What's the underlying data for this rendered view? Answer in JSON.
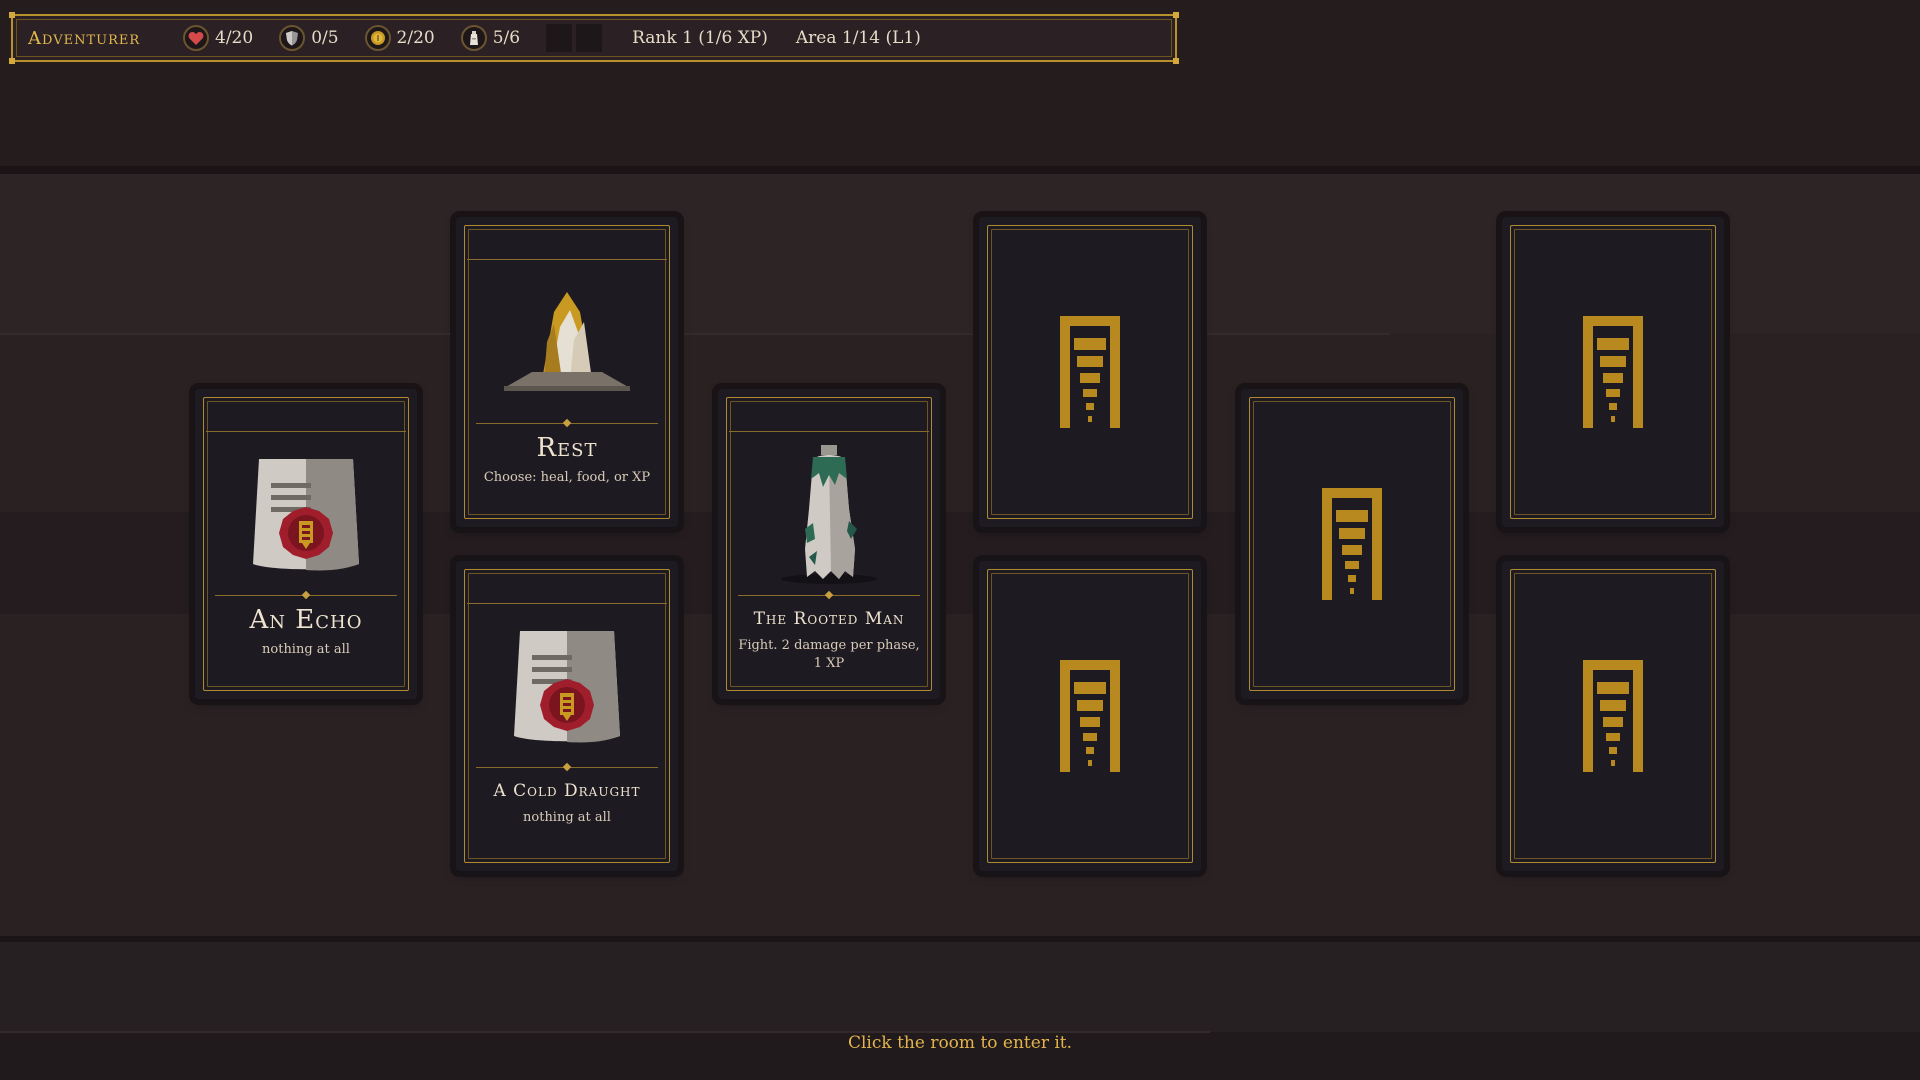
{
  "hud": {
    "title": "Adventurer",
    "health": "4/20",
    "armor": "0/5",
    "gold": "2/20",
    "food": "5/6",
    "rank": "Rank 1 (1/6 XP)",
    "area": "Area 1/14 (L1)"
  },
  "cards": {
    "echo": {
      "title": "An Echo",
      "desc": "nothing at all"
    },
    "rest": {
      "title": "Rest",
      "desc": "Choose: heal, food, or XP"
    },
    "cold_draught": {
      "title": "A Cold Draught",
      "desc": "nothing at all"
    },
    "rooted_man": {
      "title": "The Rooted Man",
      "desc": "Fight. 2 damage per phase, 1 XP"
    }
  },
  "footer": {
    "hint": "Click the room to enter it."
  },
  "colors": {
    "gold": "#b08a30",
    "card_bg": "#1e1a22",
    "seal_red": "#a81e2e",
    "text_gold": "#e3b44c"
  },
  "icons": {
    "health": "heart-icon",
    "armor": "shield-icon",
    "gold": "coin-icon",
    "food": "flask-icon",
    "card_back": "dungeon-door-icon"
  }
}
